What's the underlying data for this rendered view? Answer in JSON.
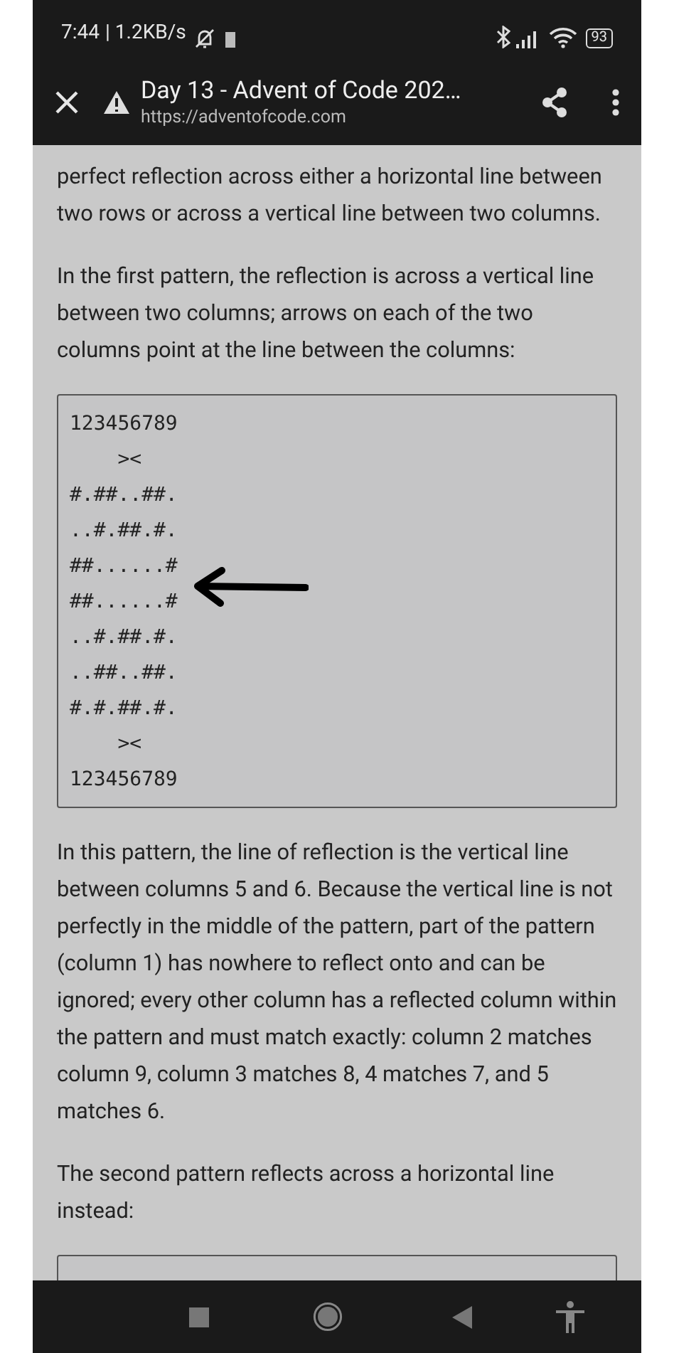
{
  "status_bar": {
    "time": "7:44",
    "speed": "| 1.2KB/s",
    "battery": "93"
  },
  "toolbar": {
    "title": "Day 13 - Advent of Code 202…",
    "url": "https://adventofcode.com"
  },
  "article": {
    "paragraphs_top": [
      "perfect reflection across either a horizontal line between two rows or across a vertical line between two columns.",
      "In the first pattern, the reflection is across a vertical line between two columns; arrows on each of the two columns point at the line between the columns:"
    ],
    "code_lines": [
      "123456789",
      "    ><",
      "#.##..##.",
      "..#.##.#.",
      "##......#",
      "##......#",
      "..#.##.#.",
      "..##..##.",
      "#.#.##.#.",
      "    ><",
      "123456789"
    ],
    "paragraphs_bottom": [
      "In this pattern, the line of reflection is the vertical line between columns 5 and 6. Because the vertical line is not perfectly in the middle of the pattern, part of the pattern (column 1) has nowhere to reflect onto and can be ignored; every other column has a reflected column within the pattern and must match exactly: column 2 matches column 9, column 3 matches 8, 4 matches 7, and 5 matches 6.",
      "The second pattern reflects across a horizontal line instead:"
    ]
  }
}
